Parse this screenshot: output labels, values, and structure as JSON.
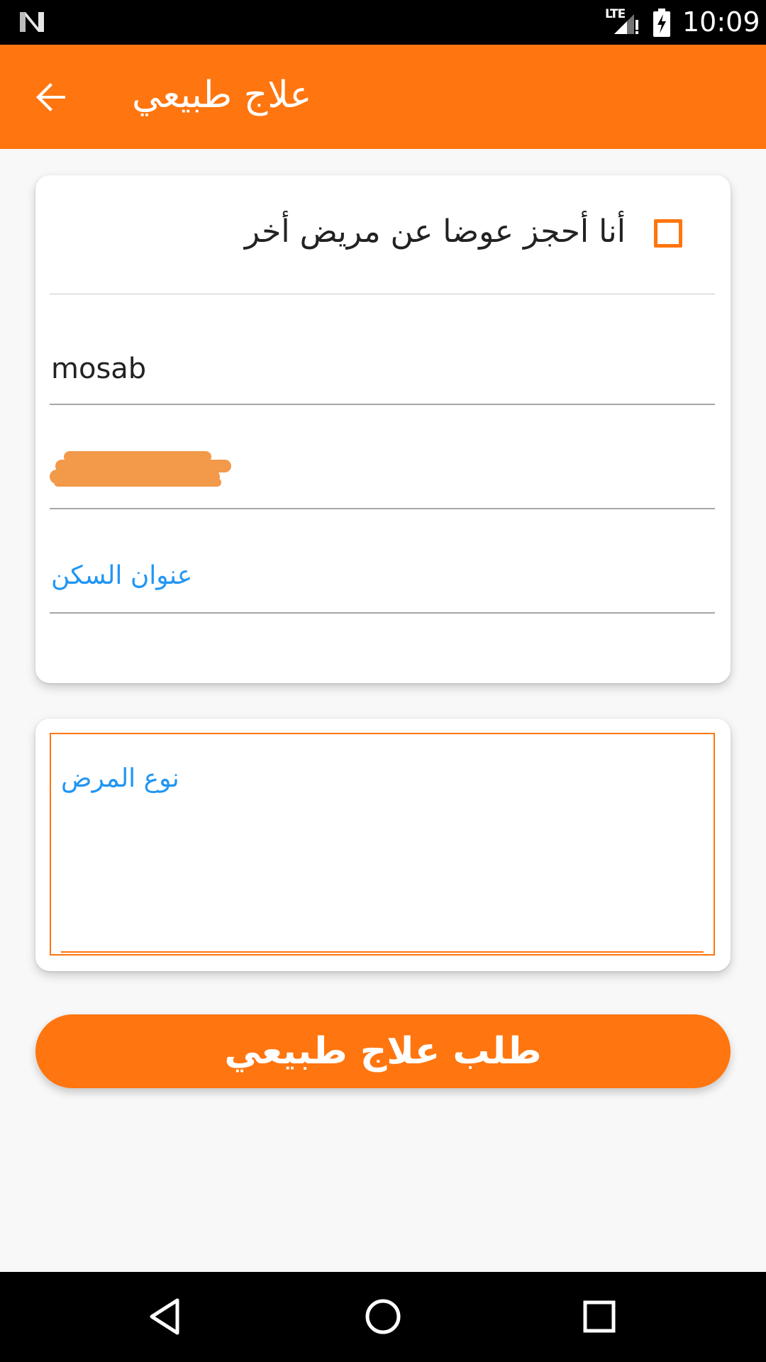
{
  "status_bar": {
    "time": "10:09",
    "network": "LTE",
    "icons": [
      "notification-n-icon",
      "lte-signal-icon",
      "battery-charging-icon"
    ]
  },
  "app_bar": {
    "title": "علاج طبيعي",
    "back_icon": "arrow-back-icon"
  },
  "form": {
    "checkbox": {
      "label": "أنا أحجز عوضا عن مريض أخر",
      "checked": false
    },
    "name_field": {
      "value": "mosab"
    },
    "phone_field": {
      "value": "",
      "redacted": true
    },
    "address_field": {
      "placeholder": "عنوان السكن"
    },
    "disease_type_field": {
      "placeholder": "نوع المرض"
    },
    "submit_label": "طلب علاج طبيعي"
  },
  "nav_bar": {
    "icons": [
      "nav-back-icon",
      "nav-home-icon",
      "nav-recents-icon"
    ]
  },
  "colors": {
    "accent": "#ff750f",
    "placeholder": "#2196f3",
    "background": "#f8f8f8"
  }
}
